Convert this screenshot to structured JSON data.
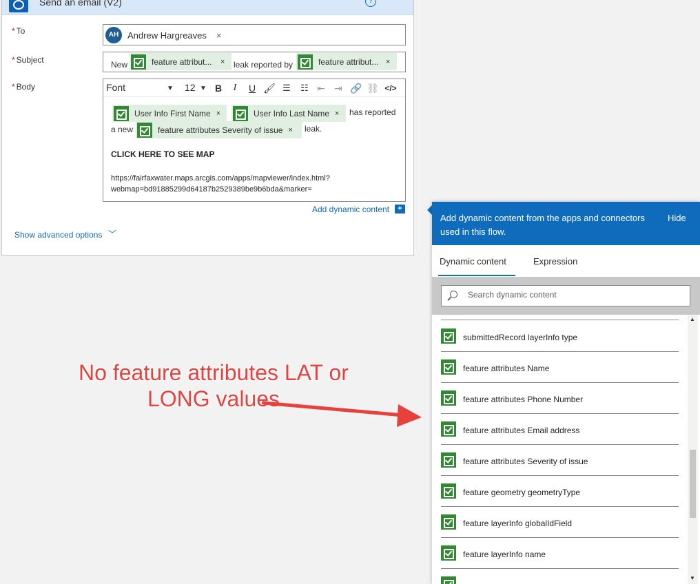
{
  "card": {
    "title": "Send an email (V2)",
    "help_glyph": "?",
    "more_glyph": "···",
    "to_label": "To",
    "subject_label": "Subject",
    "body_label": "Body",
    "required_mark": "*",
    "recipient": {
      "initials": "AH",
      "name": "Andrew Hargreaves",
      "remove": "×"
    },
    "subject": {
      "text_1": "New",
      "token_1": "feature attribut...",
      "text_2": "leak reported by",
      "token_2": "feature attribut..."
    },
    "toolbar": {
      "font": "Font",
      "size": "12",
      "bold": "B",
      "italic": "I",
      "underline": "U",
      "code": "</>"
    },
    "body": {
      "token_first_name": "User Info First Name",
      "token_last_name": "User Info Last Name",
      "text_has_reported": "has reported",
      "text_a_new": "a new",
      "token_severity": "feature attributes Severity of issue",
      "text_leak": "leak.",
      "cta": "CLICK HERE TO SEE MAP",
      "url_line_1": "https://fairfaxwater.maps.arcgis.com/apps/mapviewer/index.html?",
      "url_line_2": "webmap=bd91885299d64187b2529389be9b6bda&marker="
    },
    "token_remove": "×",
    "add_dynamic_label": "Add dynamic content",
    "add_dynamic_glyph": "+",
    "advanced_label": "Show advanced options",
    "advanced_chevron": "﹀"
  },
  "panel": {
    "header_text": "Add dynamic content from the apps and connectors used in this flow.",
    "hide_label": "Hide",
    "tabs": [
      "Dynamic content",
      "Expression"
    ],
    "search_placeholder": "Search dynamic content",
    "items": [
      "submittedRecord layerInfo type",
      "feature attributes Name",
      "feature attributes Phone Number",
      "feature attributes Email address",
      "feature attributes Severity of issue",
      "feature geometry geometryType",
      "feature layerInfo globalIdField",
      "feature layerInfo name"
    ],
    "scroll_up": "▲",
    "scroll_down": "▼"
  },
  "annotation": {
    "line_1": "No feature attributes LAT or",
    "line_2": "LONG values",
    "color": "#e8403c"
  },
  "colors": {
    "accent": "#0f6cbd",
    "token_bg": "#e0efe1",
    "token_icon": "#2f8a32",
    "required": "#a4262c"
  }
}
